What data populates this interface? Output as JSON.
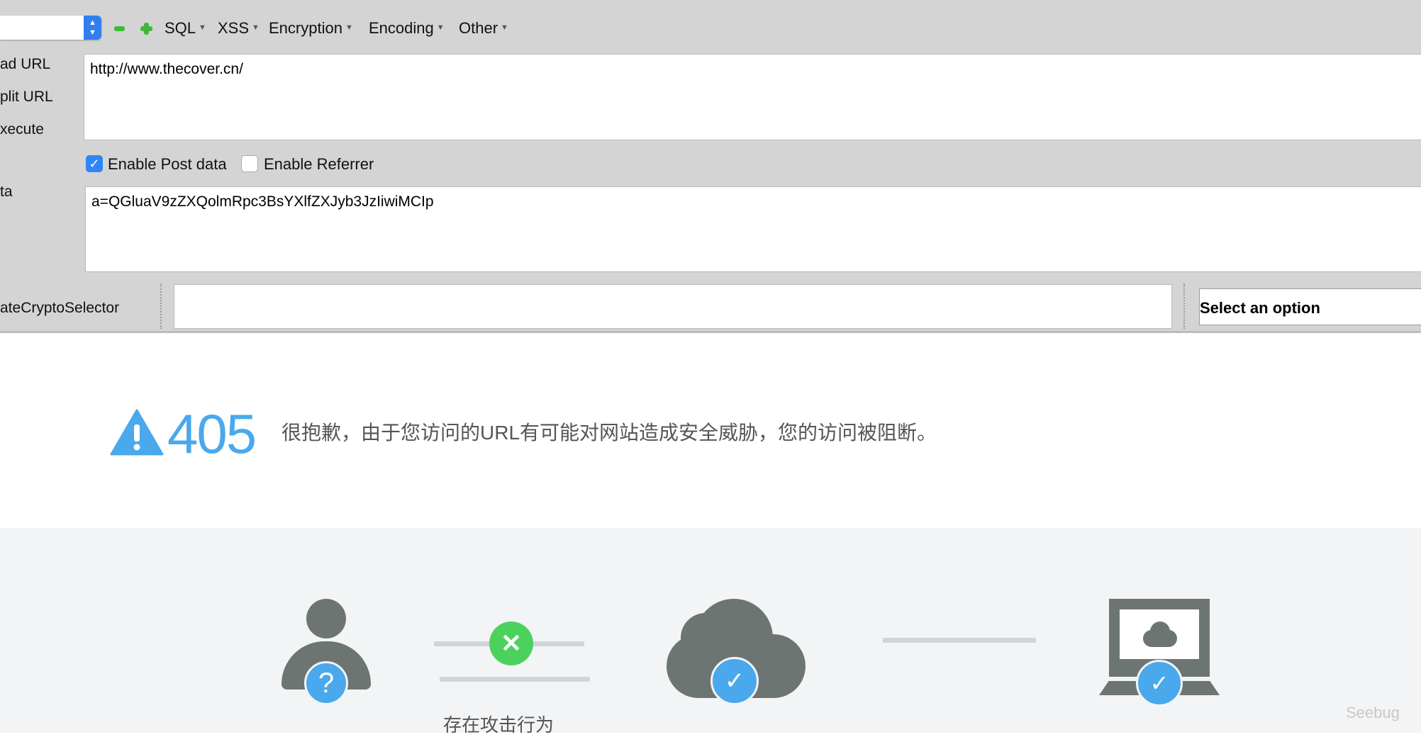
{
  "toolbar": {
    "menus": [
      "SQL",
      "XSS",
      "Encryption",
      "Encoding",
      "Other"
    ]
  },
  "labels": {
    "load_url": "ad URL",
    "split_url": "plit URL",
    "execute": "xecute",
    "post_data": "ta",
    "crypto": "ateCryptoSelector"
  },
  "url_field": {
    "value": "http://www.thecover.cn/"
  },
  "options": {
    "post_data": "Enable Post data",
    "referrer": "Enable Referrer",
    "post_checked": true,
    "referrer_checked": false
  },
  "post_field": {
    "value": "a=QGluaV9zZXQolmRpc3BsYXlfZXJyb3JzIiwiMCIp"
  },
  "crypto": {
    "select_value": "Select an option"
  },
  "error": {
    "code": "405",
    "message": "很抱歉，由于您访问的URL有可能对网站造成安全威胁，您的访问被阻断。"
  },
  "diagram": {
    "caption_attack": "存在攻击行为"
  },
  "watermark": "Seebug",
  "colors": {
    "blue": "#4aa8ec",
    "green": "#4cd25c",
    "icon_gray": "#6d7573"
  }
}
